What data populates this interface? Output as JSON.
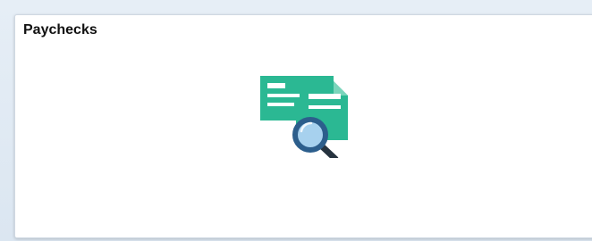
{
  "tile": {
    "title": "Paychecks",
    "icon": "paycheck-search-icon"
  },
  "colors": {
    "check_green": "#2bb893",
    "check_fold": "#7ad5bb",
    "magnifier_ring": "#2c5e8c",
    "magnifier_glass": "#a7d1ee",
    "magnifier_handle": "#26333f"
  }
}
